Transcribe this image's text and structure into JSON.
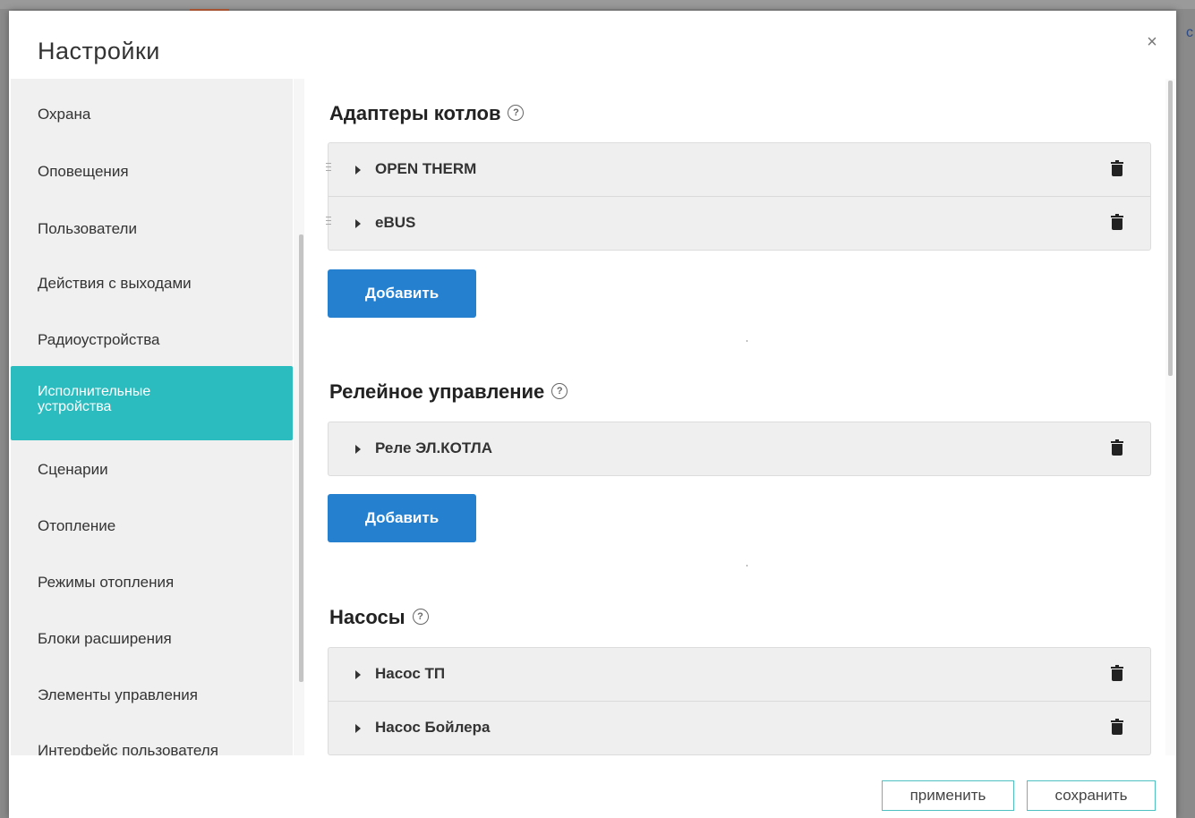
{
  "dialog": {
    "title": "Настройки",
    "close_symbol": "×"
  },
  "sidebar": {
    "items": [
      {
        "label": "Охрана"
      },
      {
        "label": "Оповещения"
      },
      {
        "label": "Пользователи"
      },
      {
        "label": "Действия с выходами"
      },
      {
        "label": "Радиоустройства"
      },
      {
        "label": "Исполнительные устройства",
        "active": true
      },
      {
        "label": "Сценарии"
      },
      {
        "label": "Отопление"
      },
      {
        "label": "Режимы отопления"
      },
      {
        "label": "Блоки расширения"
      },
      {
        "label": "Элементы управления"
      },
      {
        "label": "Интерфейс пользователя"
      }
    ]
  },
  "sections": [
    {
      "title": "Адаптеры котлов",
      "items": [
        "OPEN THERM",
        "eBUS"
      ],
      "draggable": true,
      "add_label": "Добавить"
    },
    {
      "title": "Релейное управление",
      "items": [
        "Реле ЭЛ.КОТЛА"
      ],
      "draggable": false,
      "add_label": "Добавить"
    },
    {
      "title": "Насосы",
      "items": [
        "Насос ТП",
        "Насос Бойлера"
      ],
      "draggable": false
    }
  ],
  "icons": {
    "help": "help-icon",
    "trash": "trash-icon",
    "caret": "caret-right-icon",
    "drag": "drag-handle-icon",
    "close": "close-icon"
  },
  "footer": {
    "apply_label": "применить",
    "save_label": "сохранить"
  },
  "colors": {
    "active_item": "#2bbcbf",
    "primary_button": "#2580d0",
    "footer_button_border": "#4ec0c2"
  }
}
